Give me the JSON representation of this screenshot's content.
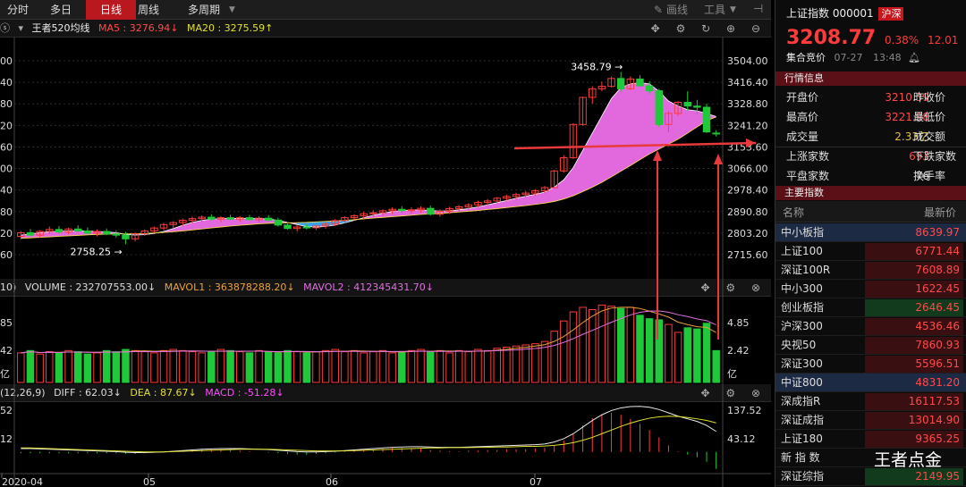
{
  "topbar": {
    "tabs": [
      "分时",
      "多日",
      "日线",
      "周线",
      "多周期"
    ],
    "active_tab": "日线",
    "draw_label": "画线",
    "tools_label": "工具"
  },
  "kline": {
    "indicator_name": "王者520均线",
    "ma5": "MA5 : 3276.94↓",
    "ma20": "MA20 : 3275.59↑",
    "y_ticks_right": [
      "3504.00",
      "3416.40",
      "3328.80",
      "3241.20",
      "3153.60",
      "3066.00",
      "2978.40",
      "2890.80",
      "2803.20",
      "2715.60"
    ],
    "y_ticks_left": [
      "00",
      "40",
      "80",
      "20",
      "60",
      "00",
      "40",
      "80",
      "20",
      "60"
    ],
    "annotation_high": "3458.79",
    "annotation_low": "2758.25"
  },
  "volume": {
    "prefix": "10)",
    "volume": "VOLUME : 232707553.00↓",
    "mavol1": "MAVOL1 : 363878288.20↓",
    "mavol2": "MAVOL2 : 412345431.70↓",
    "ticks_right": [
      "4.85",
      "2.42",
      "亿"
    ],
    "ticks_left": [
      "85",
      "42",
      "亿"
    ]
  },
  "macd": {
    "prefix": "(12,26,9)",
    "diff": "DIFF : 62.03↓",
    "dea": "DEA : 87.67↓",
    "macd": "MACD : -51.28↓",
    "ticks_right": [
      "137.52",
      "43.12"
    ],
    "ticks_left": [
      "52",
      "12"
    ]
  },
  "xaxis": [
    "2020-04",
    "05",
    "06",
    "07"
  ],
  "quote": {
    "name": "上证指数 000001",
    "market_badge": "沪深",
    "price": "3208.77",
    "change_pct": "0.38%",
    "change": "12.01",
    "auction_label": "集合竞价",
    "date": "07-27",
    "time": "13:48"
  },
  "market_info": {
    "section_title": "行情信息",
    "open_label": "开盘价",
    "open": "3210.39",
    "prev_close_label": "昨收价",
    "high_label": "最高价",
    "high": "3221.98",
    "low_label": "最低价",
    "volume_label": "成交量",
    "volume": "2.33亿",
    "amount_label": "成交额",
    "up_label": "上涨家数",
    "up": "693",
    "down_label": "下跌家数",
    "flat_label": "平盘家数",
    "flat": "76",
    "turnover_label": "换手率"
  },
  "indices": {
    "section_title": "主要指数",
    "col_name": "名称",
    "col_price": "最新价",
    "rows": [
      {
        "name": "中小板指",
        "price": "8639.97"
      },
      {
        "name": "上证100",
        "price": "6771.44"
      },
      {
        "name": "深证100R",
        "price": "7608.89"
      },
      {
        "name": "中小300",
        "price": "1622.45"
      },
      {
        "name": "创业板指",
        "price": "2646.45"
      },
      {
        "name": "沪深300",
        "price": "4536.46"
      },
      {
        "name": "央视50",
        "price": "7860.93"
      },
      {
        "name": "深证300",
        "price": "5596.51"
      },
      {
        "name": "中证800",
        "price": "4831.20"
      },
      {
        "name": "深成指R",
        "price": "16117.53"
      },
      {
        "name": "深证成指",
        "price": "13014.90"
      },
      {
        "name": "上证180",
        "price": "9365.25"
      },
      {
        "name": "新 指 数",
        "price": ""
      },
      {
        "name": "深证综指",
        "price": "2149.95"
      }
    ]
  },
  "watermark": "王者点金",
  "colors": {
    "up": "#ff3b3b",
    "down": "#1fc93a",
    "ma_band": "#ee6ee9",
    "active_tab": "#b8181e",
    "section": "#5a1016"
  },
  "chart_data": {
    "type": "candlestick",
    "title": "",
    "period": "daily",
    "x_labels": [
      "2020-04",
      "05",
      "06",
      "07"
    ],
    "ylim": [
      2715.6,
      3504.0
    ],
    "candles": [
      {
        "o": 2790,
        "h": 2812,
        "l": 2778,
        "c": 2805
      },
      {
        "o": 2805,
        "h": 2820,
        "l": 2790,
        "c": 2795
      },
      {
        "o": 2795,
        "h": 2815,
        "l": 2785,
        "c": 2810
      },
      {
        "o": 2810,
        "h": 2830,
        "l": 2800,
        "c": 2818
      },
      {
        "o": 2818,
        "h": 2832,
        "l": 2800,
        "c": 2808
      },
      {
        "o": 2808,
        "h": 2825,
        "l": 2798,
        "c": 2820
      },
      {
        "o": 2820,
        "h": 2835,
        "l": 2805,
        "c": 2812
      },
      {
        "o": 2812,
        "h": 2826,
        "l": 2798,
        "c": 2803
      },
      {
        "o": 2803,
        "h": 2818,
        "l": 2790,
        "c": 2810
      },
      {
        "o": 2810,
        "h": 2822,
        "l": 2795,
        "c": 2800
      },
      {
        "o": 2800,
        "h": 2815,
        "l": 2785,
        "c": 2795
      },
      {
        "o": 2795,
        "h": 2808,
        "l": 2758,
        "c": 2780
      },
      {
        "o": 2780,
        "h": 2805,
        "l": 2770,
        "c": 2800
      },
      {
        "o": 2800,
        "h": 2818,
        "l": 2792,
        "c": 2812
      },
      {
        "o": 2812,
        "h": 2830,
        "l": 2805,
        "c": 2824
      },
      {
        "o": 2824,
        "h": 2845,
        "l": 2815,
        "c": 2838
      },
      {
        "o": 2838,
        "h": 2852,
        "l": 2825,
        "c": 2846
      },
      {
        "o": 2846,
        "h": 2862,
        "l": 2832,
        "c": 2855
      },
      {
        "o": 2855,
        "h": 2870,
        "l": 2843,
        "c": 2862
      },
      {
        "o": 2862,
        "h": 2875,
        "l": 2850,
        "c": 2868
      },
      {
        "o": 2868,
        "h": 2880,
        "l": 2855,
        "c": 2860
      },
      {
        "o": 2860,
        "h": 2872,
        "l": 2848,
        "c": 2866
      },
      {
        "o": 2866,
        "h": 2878,
        "l": 2855,
        "c": 2860
      },
      {
        "o": 2860,
        "h": 2872,
        "l": 2850,
        "c": 2866
      },
      {
        "o": 2866,
        "h": 2877,
        "l": 2855,
        "c": 2858
      },
      {
        "o": 2858,
        "h": 2872,
        "l": 2848,
        "c": 2864
      },
      {
        "o": 2864,
        "h": 2876,
        "l": 2852,
        "c": 2856
      },
      {
        "o": 2856,
        "h": 2866,
        "l": 2830,
        "c": 2836
      },
      {
        "o": 2836,
        "h": 2848,
        "l": 2818,
        "c": 2822
      },
      {
        "o": 2822,
        "h": 2836,
        "l": 2810,
        "c": 2828
      },
      {
        "o": 2828,
        "h": 2842,
        "l": 2818,
        "c": 2825
      },
      {
        "o": 2825,
        "h": 2838,
        "l": 2815,
        "c": 2832
      },
      {
        "o": 2832,
        "h": 2848,
        "l": 2822,
        "c": 2840
      },
      {
        "o": 2840,
        "h": 2860,
        "l": 2832,
        "c": 2854
      },
      {
        "o": 2854,
        "h": 2872,
        "l": 2845,
        "c": 2866
      },
      {
        "o": 2866,
        "h": 2880,
        "l": 2855,
        "c": 2874
      },
      {
        "o": 2874,
        "h": 2890,
        "l": 2862,
        "c": 2882
      },
      {
        "o": 2882,
        "h": 2896,
        "l": 2870,
        "c": 2886
      },
      {
        "o": 2886,
        "h": 2900,
        "l": 2874,
        "c": 2894
      },
      {
        "o": 2894,
        "h": 2908,
        "l": 2880,
        "c": 2900
      },
      {
        "o": 2900,
        "h": 2912,
        "l": 2885,
        "c": 2895
      },
      {
        "o": 2895,
        "h": 2908,
        "l": 2882,
        "c": 2898
      },
      {
        "o": 2898,
        "h": 2912,
        "l": 2886,
        "c": 2904
      },
      {
        "o": 2904,
        "h": 2915,
        "l": 2875,
        "c": 2880
      },
      {
        "o": 2880,
        "h": 2900,
        "l": 2870,
        "c": 2892
      },
      {
        "o": 2892,
        "h": 2910,
        "l": 2882,
        "c": 2903
      },
      {
        "o": 2903,
        "h": 2918,
        "l": 2892,
        "c": 2910
      },
      {
        "o": 2910,
        "h": 2925,
        "l": 2900,
        "c": 2918
      },
      {
        "o": 2918,
        "h": 2935,
        "l": 2908,
        "c": 2928
      },
      {
        "o": 2928,
        "h": 2942,
        "l": 2915,
        "c": 2934
      },
      {
        "o": 2934,
        "h": 2950,
        "l": 2925,
        "c": 2945
      },
      {
        "o": 2945,
        "h": 2960,
        "l": 2935,
        "c": 2952
      },
      {
        "o": 2952,
        "h": 2968,
        "l": 2940,
        "c": 2960
      },
      {
        "o": 2960,
        "h": 2975,
        "l": 2948,
        "c": 2966
      },
      {
        "o": 2966,
        "h": 2982,
        "l": 2955,
        "c": 2975
      },
      {
        "o": 2975,
        "h": 2995,
        "l": 2965,
        "c": 2988
      },
      {
        "o": 2988,
        "h": 3060,
        "l": 2985,
        "c": 3056
      },
      {
        "o": 3056,
        "h": 3120,
        "l": 3050,
        "c": 3110
      },
      {
        "o": 3110,
        "h": 3250,
        "l": 3105,
        "c": 3245
      },
      {
        "o": 3245,
        "h": 3358,
        "l": 3240,
        "c": 3355
      },
      {
        "o": 3355,
        "h": 3400,
        "l": 3330,
        "c": 3390
      },
      {
        "o": 3390,
        "h": 3420,
        "l": 3380,
        "c": 3400
      },
      {
        "o": 3400,
        "h": 3440,
        "l": 3395,
        "c": 3432
      },
      {
        "o": 3432,
        "h": 3458.79,
        "l": 3380,
        "c": 3390
      },
      {
        "o": 3390,
        "h": 3440,
        "l": 3385,
        "c": 3430
      },
      {
        "o": 3430,
        "h": 3445,
        "l": 3395,
        "c": 3402
      },
      {
        "o": 3402,
        "h": 3420,
        "l": 3370,
        "c": 3382
      },
      {
        "o": 3382,
        "h": 3390,
        "l": 3235,
        "c": 3245
      },
      {
        "o": 3245,
        "h": 3300,
        "l": 3215,
        "c": 3290
      },
      {
        "o": 3290,
        "h": 3340,
        "l": 3280,
        "c": 3335
      },
      {
        "o": 3335,
        "h": 3380,
        "l": 3300,
        "c": 3320
      },
      {
        "o": 3320,
        "h": 3345,
        "l": 3285,
        "c": 3315
      },
      {
        "o": 3315,
        "h": 3330,
        "l": 3210,
        "c": 3215
      },
      {
        "o": 3210,
        "h": 3222,
        "l": 3196,
        "c": 3208.77
      }
    ],
    "volume_ylim": [
      0,
      7.3
    ],
    "volume_values": [
      2.6,
      2.8,
      2.5,
      2.7,
      2.6,
      2.8,
      2.7,
      2.5,
      2.6,
      2.8,
      2.7,
      2.9,
      2.8,
      2.7,
      2.6,
      2.8,
      2.9,
      2.8,
      2.7,
      2.6,
      2.7,
      2.9,
      2.8,
      2.7,
      2.6,
      2.8,
      2.7,
      2.6,
      2.8,
      2.7,
      2.6,
      2.7,
      2.8,
      2.9,
      2.7,
      2.8,
      2.6,
      2.7,
      2.8,
      2.6,
      2.7,
      2.8,
      2.9,
      2.7,
      2.8,
      2.6,
      2.8,
      2.7,
      2.9,
      2.8,
      3.0,
      3.1,
      3.2,
      3.3,
      3.4,
      3.6,
      4.5,
      5.4,
      6.2,
      6.6,
      6.4,
      6.8,
      6.7,
      6.5,
      6.6,
      5.9,
      5.6,
      5.5,
      5.1,
      4.4,
      4.8,
      4.7,
      5.2,
      2.8
    ],
    "ma_band_series": [
      {
        "name": "MA5",
        "values": [
          2795,
          2800,
          2805,
          2808,
          2811,
          2812,
          2813,
          2812,
          2810,
          2808,
          2805,
          2798,
          2795,
          2797,
          2802,
          2810,
          2822,
          2835,
          2847,
          2855,
          2860,
          2862,
          2863,
          2863,
          2862,
          2862,
          2861,
          2855,
          2847,
          2838,
          2830,
          2828,
          2830,
          2836,
          2845,
          2855,
          2866,
          2876,
          2884,
          2891,
          2895,
          2897,
          2898,
          2895,
          2893,
          2894,
          2898,
          2903,
          2910,
          2918,
          2927,
          2936,
          2945,
          2953,
          2961,
          2970,
          2990,
          3020,
          3070,
          3140,
          3210,
          3280,
          3350,
          3395,
          3410,
          3415,
          3410,
          3380,
          3340,
          3320,
          3305,
          3300,
          3290,
          3276.94
        ]
      },
      {
        "name": "MA20",
        "values": [
          2782,
          2784,
          2786,
          2788,
          2790,
          2792,
          2794,
          2796,
          2798,
          2799,
          2800,
          2800,
          2801,
          2802,
          2804,
          2806,
          2809,
          2812,
          2816,
          2820,
          2824,
          2828,
          2832,
          2835,
          2838,
          2841,
          2843,
          2844,
          2845,
          2846,
          2847,
          2849,
          2851,
          2853,
          2855,
          2858,
          2861,
          2864,
          2867,
          2870,
          2873,
          2876,
          2879,
          2881,
          2883,
          2886,
          2889,
          2892,
          2895,
          2899,
          2903,
          2907,
          2911,
          2915,
          2920,
          2925,
          2932,
          2942,
          2955,
          2972,
          2990,
          3010,
          3032,
          3055,
          3078,
          3102,
          3125,
          3145,
          3165,
          3185,
          3210,
          3235,
          3260,
          3275.59
        ]
      }
    ],
    "macd_ylim": [
      -60,
      145
    ],
    "diff_values": [
      10,
      10,
      9,
      8,
      7,
      6,
      5,
      4,
      3,
      2,
      1,
      -1,
      -2,
      -2,
      -1,
      0,
      2,
      4,
      6,
      8,
      9,
      10,
      10,
      10,
      9,
      8,
      7,
      5,
      3,
      1,
      0,
      0,
      1,
      2,
      4,
      6,
      8,
      10,
      12,
      14,
      15,
      16,
      16,
      15,
      14,
      14,
      14,
      15,
      16,
      17,
      18,
      19,
      20,
      21,
      22,
      24,
      30,
      40,
      55,
      75,
      95,
      112,
      125,
      133,
      137,
      137.52,
      135,
      128,
      118,
      108,
      100,
      92,
      80,
      62.03
    ],
    "dea_values": [
      12,
      12,
      11,
      10,
      9,
      8,
      7,
      6,
      5,
      4,
      3,
      2,
      1,
      0,
      0,
      0,
      1,
      2,
      3,
      4,
      5,
      6,
      7,
      8,
      8,
      8,
      8,
      7,
      6,
      5,
      4,
      3,
      3,
      3,
      3,
      4,
      5,
      6,
      7,
      8,
      9,
      10,
      11,
      12,
      12,
      13,
      13,
      13,
      14,
      14,
      15,
      15,
      16,
      17,
      17,
      18,
      20,
      23,
      28,
      35,
      44,
      55,
      66,
      77,
      87,
      95,
      102,
      106,
      108,
      107,
      104,
      100,
      95,
      87.67
    ]
  }
}
